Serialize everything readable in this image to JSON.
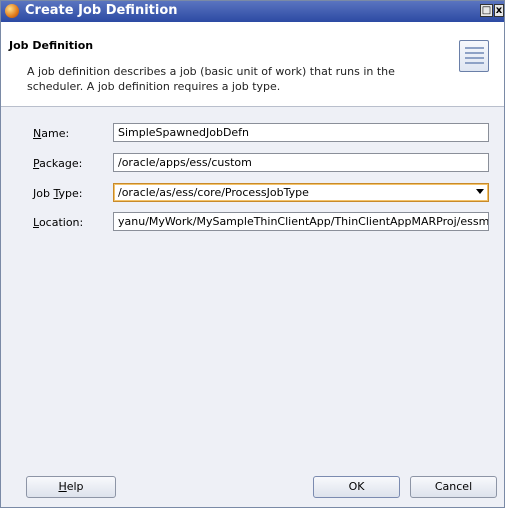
{
  "window": {
    "title": "Create Job Definition",
    "max_glyph": "□",
    "close_glyph": "x"
  },
  "header": {
    "title": "Job Definition",
    "description": "A job definition describes a job (basic unit of work) that runs in the scheduler.  A job definition requires a job type."
  },
  "form": {
    "name": {
      "label_mnemonic": "N",
      "label_rest": "ame:",
      "value": "SimpleSpawnedJobDefn"
    },
    "package": {
      "label_mnemonic": "P",
      "label_rest": "ackage:",
      "value": "/oracle/apps/ess/custom"
    },
    "job_type": {
      "label_prefix": "Job ",
      "label_mnemonic": "T",
      "label_rest": "ype:",
      "value": "/oracle/as/ess/core/ProcessJobType"
    },
    "location": {
      "label_mnemonic": "L",
      "label_rest": "ocation:",
      "value": "yanu/MyWork/MySampleThinClientApp/ThinClientAppMARProj/essmeta/"
    }
  },
  "buttons": {
    "help_mnemonic": "H",
    "help_rest": "elp",
    "ok": "OK",
    "cancel": "Cancel"
  },
  "colors": {
    "titlebar": "#2c4aa3",
    "focus_border": "#c88a2a"
  }
}
